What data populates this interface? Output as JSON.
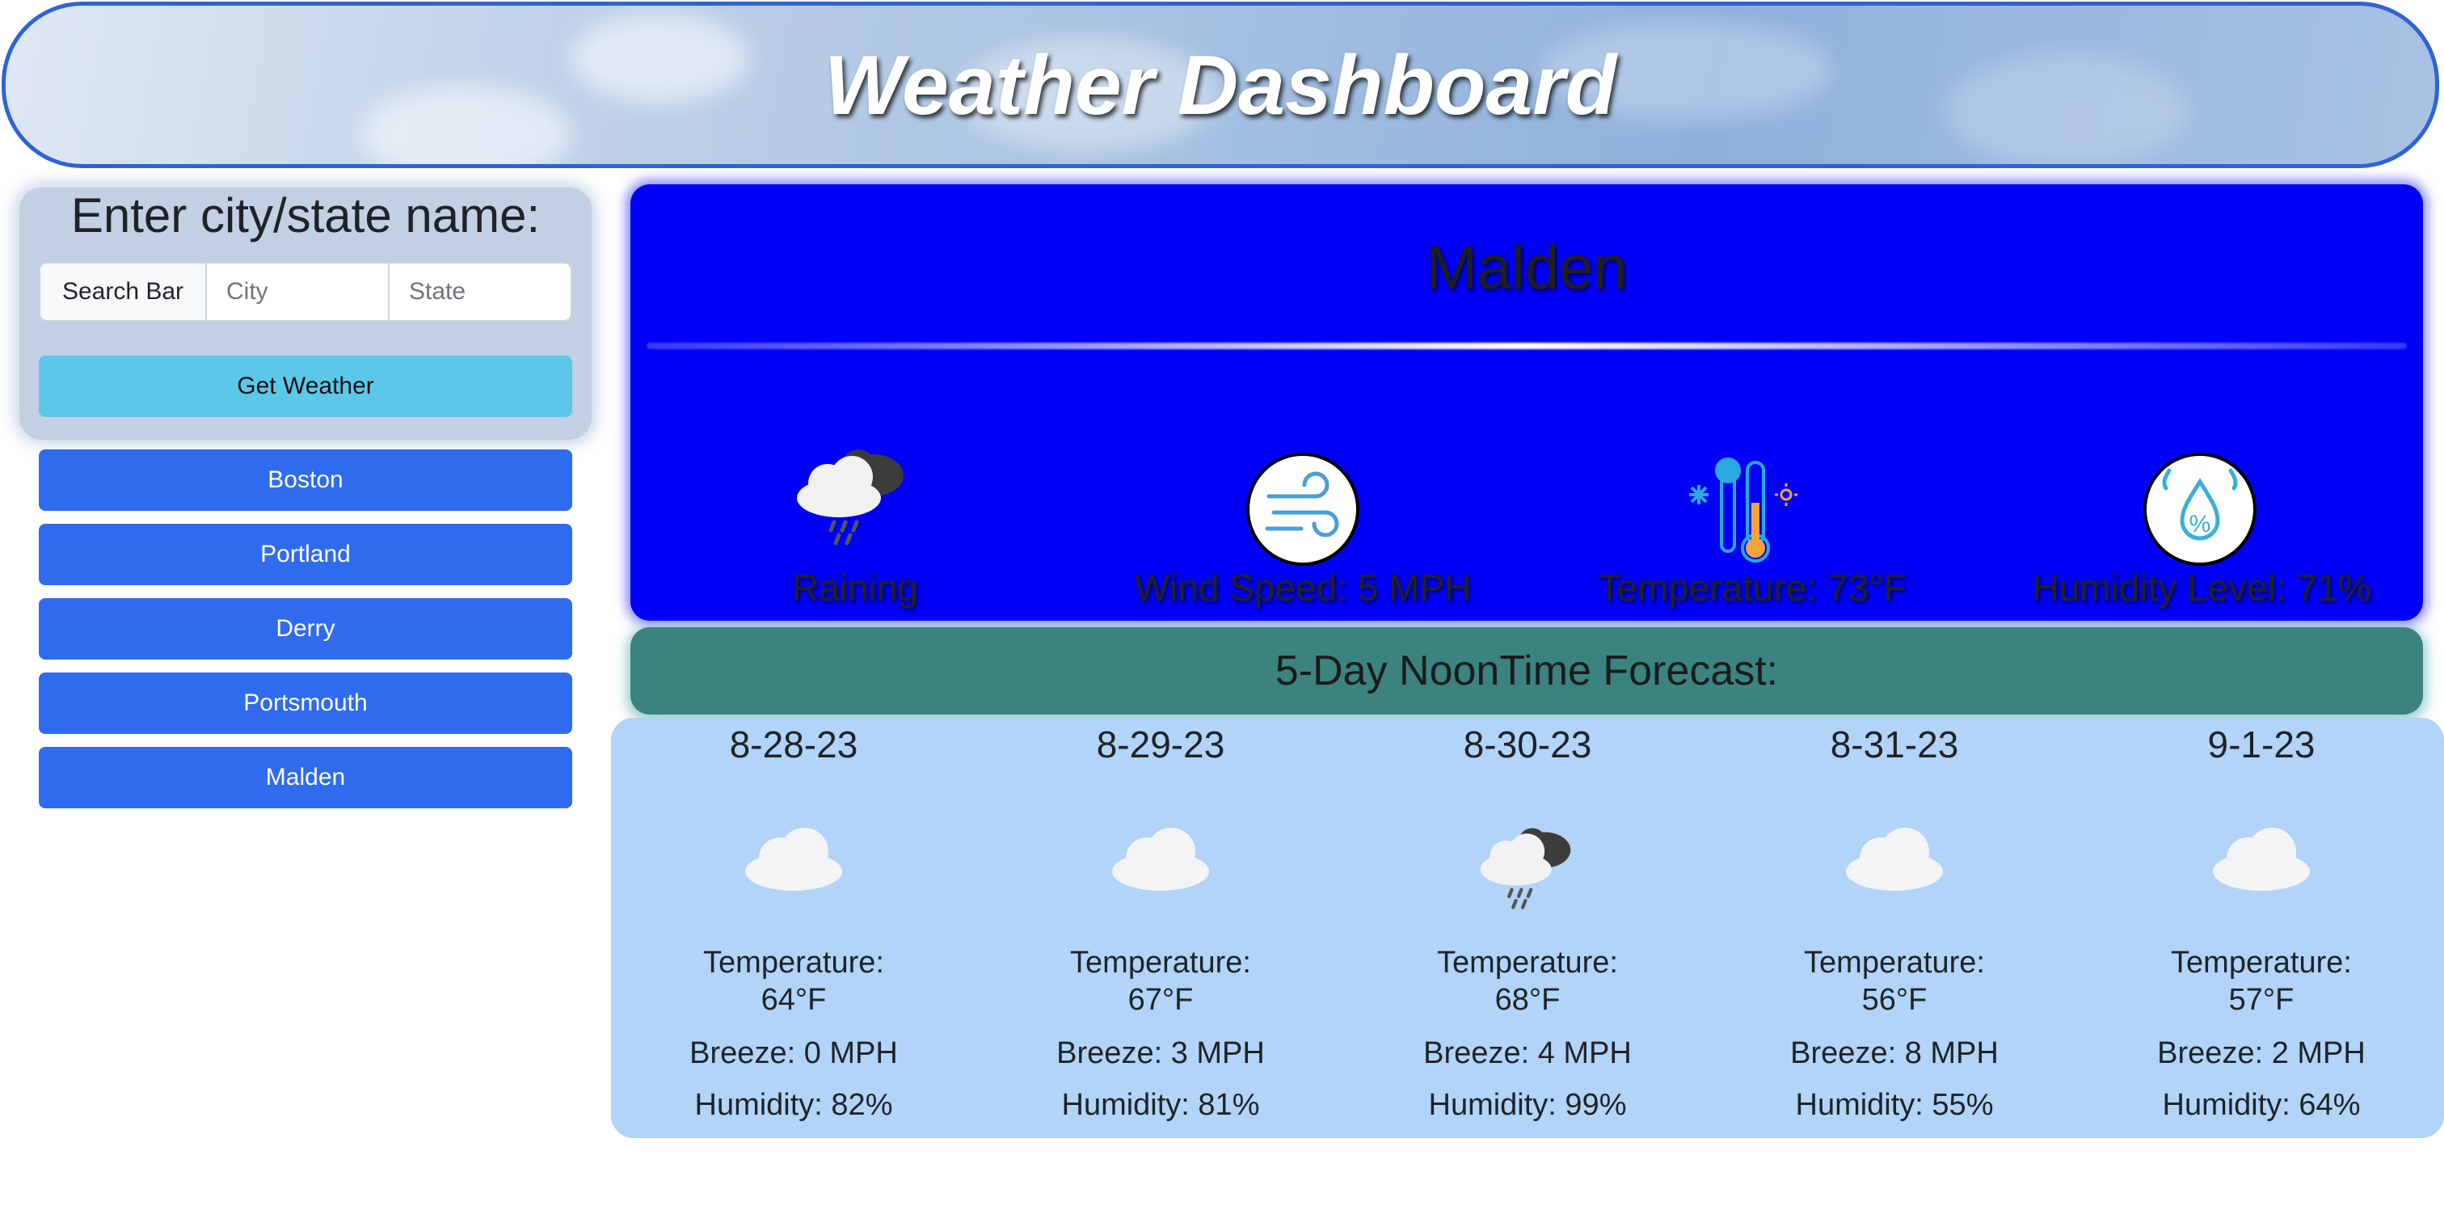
{
  "header": {
    "title": "Weather Dashboard"
  },
  "search": {
    "heading": "Enter city/state name:",
    "prefix_label": "Search Bar",
    "city_placeholder": "City",
    "state_placeholder": "State",
    "city_value": "",
    "state_value": "",
    "submit_label": "Get Weather"
  },
  "history": [
    "Boston",
    "Portland",
    "Derry",
    "Portsmouth",
    "Malden"
  ],
  "current": {
    "city": "Malden",
    "condition_icon": "rain-cloud-icon",
    "condition": "Raining",
    "wind": "Wind Speed: 5 MPH",
    "wind_icon": "wind-icon",
    "temperature": "Temperature: 73°F",
    "temperature_icon": "thermometer-icon",
    "humidity": "Humidity Level: 71%",
    "humidity_icon": "humidity-icon"
  },
  "forecast": {
    "title": "5-Day NoonTime Forecast:",
    "temp_label": "Temperature:",
    "days": [
      {
        "date": "8-28-23",
        "icon": "cloud-icon",
        "temp": "64°F",
        "breeze": "Breeze: 0 MPH",
        "humidity": "Humidity: 82%"
      },
      {
        "date": "8-29-23",
        "icon": "cloud-icon",
        "temp": "67°F",
        "breeze": "Breeze: 3 MPH",
        "humidity": "Humidity: 81%"
      },
      {
        "date": "8-30-23",
        "icon": "rain-cloud-icon",
        "temp": "68°F",
        "breeze": "Breeze: 4 MPH",
        "humidity": "Humidity: 99%"
      },
      {
        "date": "8-31-23",
        "icon": "cloud-icon",
        "temp": "56°F",
        "breeze": "Breeze: 8 MPH",
        "humidity": "Humidity: 55%"
      },
      {
        "date": "9-1-23",
        "icon": "cloud-icon",
        "temp": "57°F",
        "breeze": "Breeze: 2 MPH",
        "humidity": "Humidity: 64%"
      }
    ]
  },
  "colors": {
    "header_border": "#2e63d6",
    "current_bg": "#0000f5",
    "forecast_banner": "#3b8380",
    "forecast_panel": "#b1d4f8",
    "history_button": "#2f6bef",
    "submit_button": "#5bc8ea"
  }
}
